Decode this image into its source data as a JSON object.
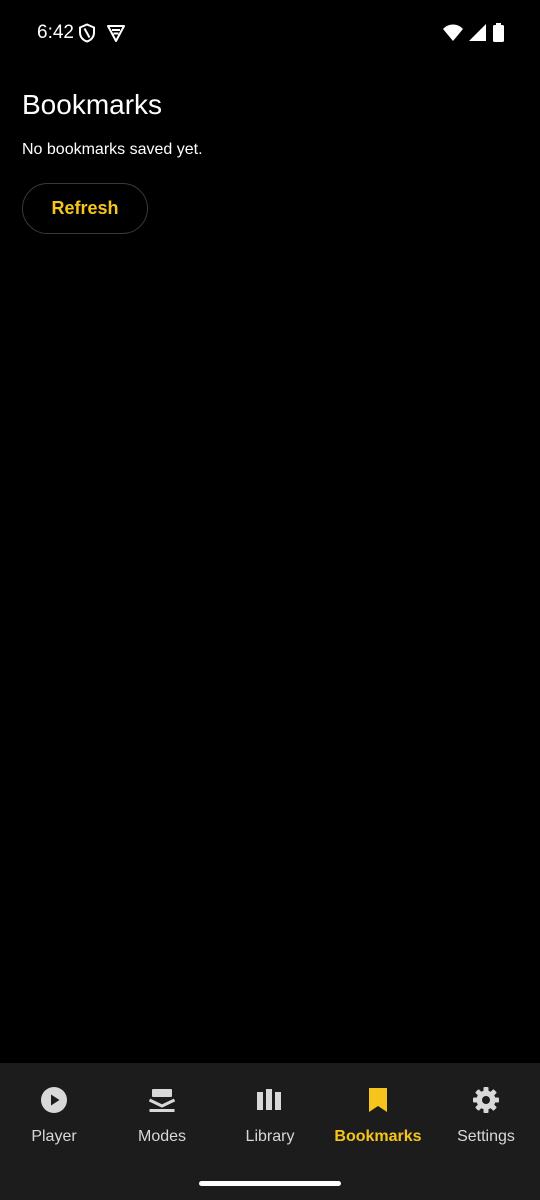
{
  "status_bar": {
    "time": "6:42",
    "left_icons": [
      "shield-icon",
      "vpn-icon"
    ],
    "right_icons": [
      "wifi-icon",
      "signal-icon",
      "battery-icon"
    ]
  },
  "page": {
    "title": "Bookmarks",
    "empty_message": "No bookmarks saved yet.",
    "refresh_label": "Refresh"
  },
  "nav": {
    "active": "Bookmarks",
    "items": [
      {
        "label": "Player",
        "icon": "play-circle-icon"
      },
      {
        "label": "Modes",
        "icon": "layers-icon"
      },
      {
        "label": "Library",
        "icon": "library-icon"
      },
      {
        "label": "Bookmarks",
        "icon": "bookmark-icon"
      },
      {
        "label": "Settings",
        "icon": "gear-icon"
      }
    ]
  },
  "colors": {
    "accent": "#f5c51b",
    "background": "#000000",
    "nav_background": "#1c1c1c",
    "nav_inactive": "#d8d8d8"
  }
}
